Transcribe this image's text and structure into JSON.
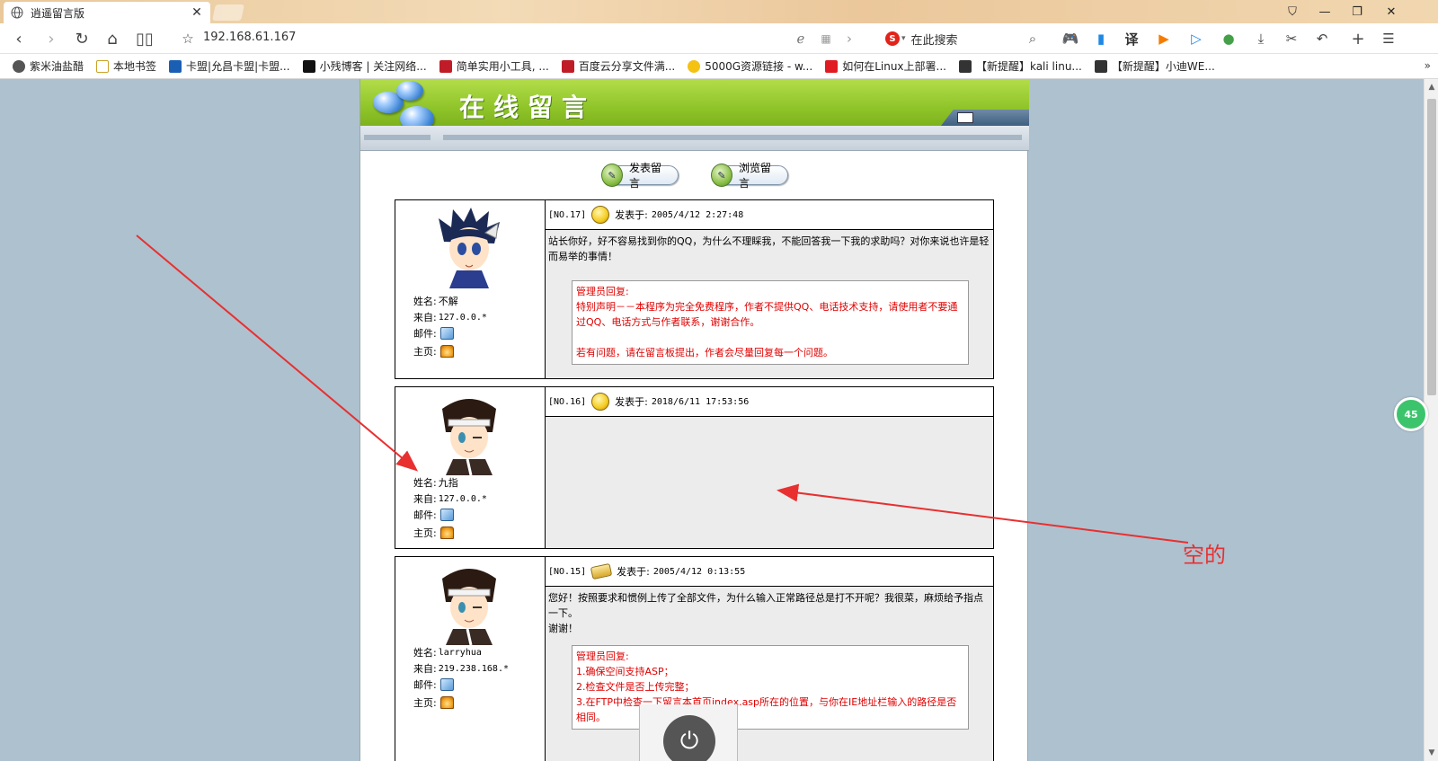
{
  "browser": {
    "tab_title": "逍遥留言版",
    "url": "192.168.61.167",
    "search_placeholder": "在此搜索",
    "translate_label": "译"
  },
  "bookmarks": [
    {
      "label": "紫米油盐醋",
      "color": "#555555"
    },
    {
      "label": "本地书签",
      "color": "#f2c14e"
    },
    {
      "label": "卡盟|允昌卡盟|卡盟...",
      "color": "#1a5fb4"
    },
    {
      "label": "小残博客 | 关注网络...",
      "color": "#111111"
    },
    {
      "label": "简单实用小工具, ...",
      "color": "#c01c28"
    },
    {
      "label": "百度云分享文件满...",
      "color": "#c01c28"
    },
    {
      "label": "5000G资源链接 - w...",
      "color": "#f5c211"
    },
    {
      "label": "如何在Linux上部署...",
      "color": "#e01b24"
    },
    {
      "label": "【新提醒】kali linu...",
      "color": "#333333"
    },
    {
      "label": "【新提醒】小迪WE...",
      "color": "#333333"
    }
  ],
  "page": {
    "banner_title": "在线留言",
    "buttons": {
      "post": "发表留言",
      "browse": "浏览留言"
    },
    "labels": {
      "name": "姓名:",
      "from": "来自:",
      "mail": "邮件:",
      "home": "主页:",
      "posted_at": "发表于:",
      "admin_reply": "管理员回复:"
    },
    "messages": [
      {
        "no": "[NO.17]",
        "time": "2005/4/12 2:27:48",
        "name": "不解",
        "ip": "127.0.0.*",
        "text": "站长你好，好不容易找到你的QQ，为什么不理睬我，不能回答我一下我的求助吗？对你来说也许是轻而易举的事情！",
        "reply_lines": [
          "特别声明－－本程序为完全免费程序，作者不提供QQ、电话技术支持，请使用者不要通过QQ、电话方式与作者联系，谢谢合作。",
          "",
          "若有问题，请在留言板提出，作者会尽量回复每一个问题。"
        ]
      },
      {
        "no": "[NO.16]",
        "time": "2018/6/11 17:53:56",
        "name": "九指",
        "ip": "127.0.0.*",
        "text": "",
        "reply_lines": []
      },
      {
        "no": "[NO.15]",
        "time": "2005/4/12 0:13:55",
        "name": "larryhua",
        "ip": "219.238.168.*",
        "text_lines": [
          "您好！按照要求和惯例上传了全部文件，为什么输入正常路径总是打不开呢？我很菜，麻烦给予指点一下。",
          "谢谢！"
        ],
        "reply_lines": [
          "1.确保空间支持ASP；",
          "2.检查文件是否上传完整；",
          "3.在FTP中检查一下留言本首页index.asp所在的位置，与你在IE地址栏输入的路径是否相同。"
        ]
      }
    ]
  },
  "annotation": {
    "text": "空的",
    "color": "#e83030"
  },
  "side_badge": "45"
}
